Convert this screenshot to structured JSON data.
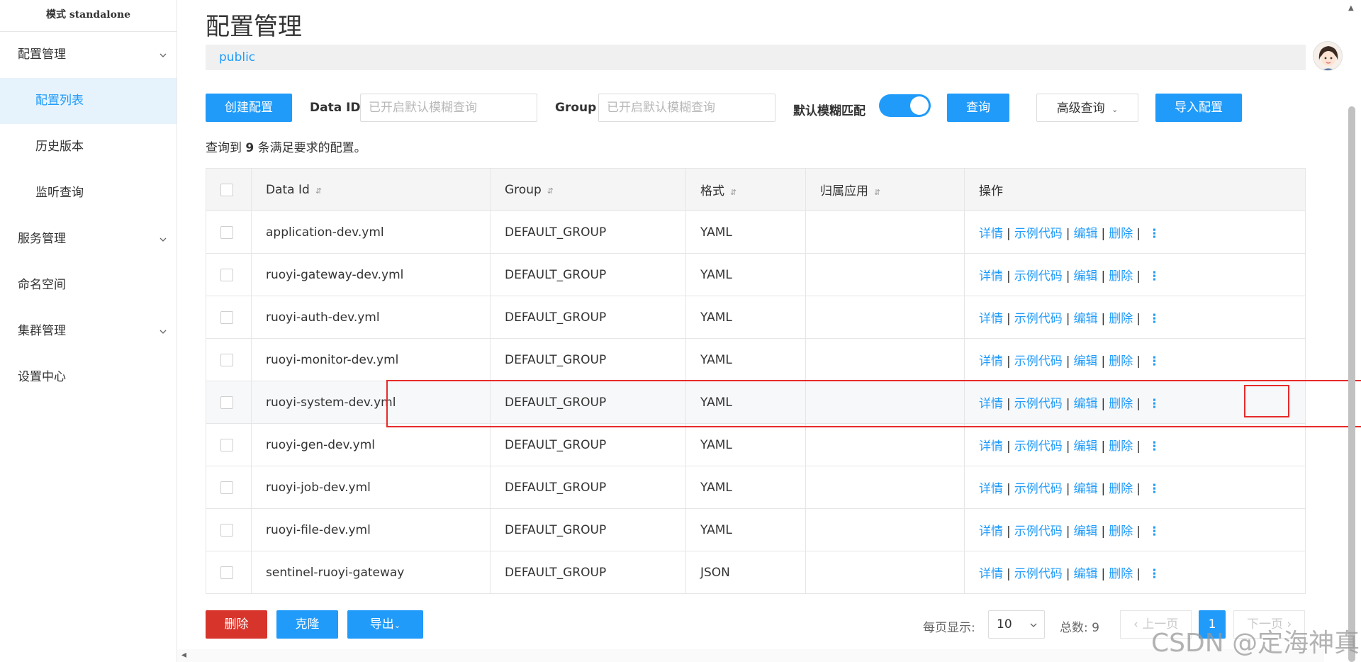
{
  "sidebar": {
    "mode": "模式 standalone",
    "items": [
      {
        "label": "配置管理"
      },
      {
        "label": "配置列表"
      },
      {
        "label": "历史版本"
      },
      {
        "label": "监听查询"
      },
      {
        "label": "服务管理"
      },
      {
        "label": "命名空间"
      },
      {
        "label": "集群管理"
      },
      {
        "label": "设置中心"
      }
    ]
  },
  "header": {
    "title": "配置管理",
    "namespace": "public"
  },
  "toolbar": {
    "create_label": "创建配置",
    "dataid_label": "Data ID",
    "dataid_placeholder": "已开启默认模糊查询",
    "group_label": "Group",
    "group_placeholder": "已开启默认模糊查询",
    "fuzzy_label": "默认模糊匹配",
    "fuzzy_on": true,
    "query_label": "查询",
    "advanced_label": "高级查询",
    "import_label": "导入配置"
  },
  "result": {
    "prefix": "查询到",
    "count": "9",
    "suffix": "条满足要求的配置。"
  },
  "table": {
    "headers": [
      "Data Id",
      "Group",
      "格式",
      "归属应用",
      "操作"
    ],
    "rows": [
      {
        "dataId": "application-dev.yml",
        "group": "DEFAULT_GROUP",
        "format": "YAML",
        "app": ""
      },
      {
        "dataId": "ruoyi-gateway-dev.yml",
        "group": "DEFAULT_GROUP",
        "format": "YAML",
        "app": ""
      },
      {
        "dataId": "ruoyi-auth-dev.yml",
        "group": "DEFAULT_GROUP",
        "format": "YAML",
        "app": ""
      },
      {
        "dataId": "ruoyi-monitor-dev.yml",
        "group": "DEFAULT_GROUP",
        "format": "YAML",
        "app": ""
      },
      {
        "dataId": "ruoyi-system-dev.yml",
        "group": "DEFAULT_GROUP",
        "format": "YAML",
        "app": ""
      },
      {
        "dataId": "ruoyi-gen-dev.yml",
        "group": "DEFAULT_GROUP",
        "format": "YAML",
        "app": ""
      },
      {
        "dataId": "ruoyi-job-dev.yml",
        "group": "DEFAULT_GROUP",
        "format": "YAML",
        "app": ""
      },
      {
        "dataId": "ruoyi-file-dev.yml",
        "group": "DEFAULT_GROUP",
        "format": "YAML",
        "app": ""
      },
      {
        "dataId": "sentinel-ruoyi-gateway",
        "group": "DEFAULT_GROUP",
        "format": "JSON",
        "app": ""
      }
    ],
    "actions": {
      "detail": "详情",
      "sample": "示例代码",
      "edit": "编辑",
      "delete": "删除",
      "sep": "|"
    }
  },
  "footer": {
    "delete_label": "删除",
    "clone_label": "克隆",
    "export_label": "导出",
    "page_size_label": "每页显示:",
    "page_size": "10",
    "total_label": "总数: 9",
    "prev_label": "上一页",
    "current_page": "1",
    "next_label": "下一页"
  },
  "watermark": "CSDN @定海神真",
  "colors": {
    "primary": "#209bfa",
    "danger": "#d7352b",
    "highlight": "#e62b2b"
  }
}
